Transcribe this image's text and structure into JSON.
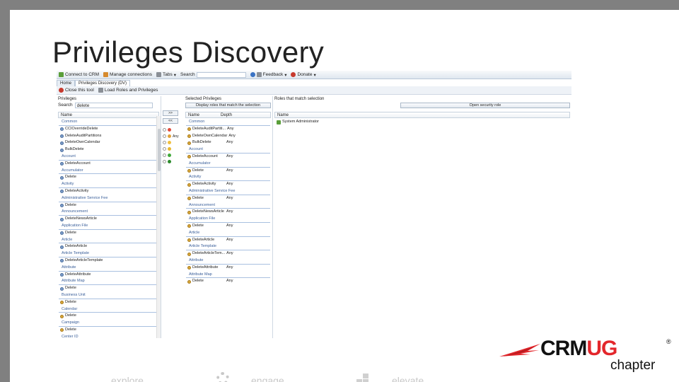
{
  "slide": {
    "title": "Privileges Discovery"
  },
  "toolbar": {
    "connect": "Connect to CRM",
    "manage": "Manage connections",
    "tabs": "Tabs",
    "search_label": "Search",
    "feedback": "Feedback",
    "donate": "Donate"
  },
  "tabs": [
    {
      "label": "Home"
    },
    {
      "label": "Privileges Discovery (DV)"
    }
  ],
  "actions": {
    "close": "Close this tool",
    "load": "Load Roles and Privileges"
  },
  "privileges_panel": {
    "title": "Privileges",
    "search_label": "Search",
    "search_value": "delete",
    "col_name": "Name",
    "add_btn": ">>",
    "remove_btn": "<<",
    "rows": [
      {
        "t": "g",
        "text": "Common"
      },
      {
        "t": "r",
        "text": "CCIOverrideDelete",
        "k": "blue"
      },
      {
        "t": "r",
        "text": "DeleteAuditPartitions",
        "k": "blue"
      },
      {
        "t": "r",
        "text": "DeleteOwnCalendar",
        "k": "blue"
      },
      {
        "t": "r",
        "text": "BulkDelete",
        "k": "blue"
      },
      {
        "t": "g",
        "text": "Account"
      },
      {
        "t": "r",
        "text": "DeleteAccount",
        "k": "blue"
      },
      {
        "t": "g",
        "text": "Accumulator"
      },
      {
        "t": "r",
        "text": "Delete",
        "k": "blue"
      },
      {
        "t": "g",
        "text": "Activity"
      },
      {
        "t": "r",
        "text": "DeleteActivity",
        "k": "blue"
      },
      {
        "t": "g",
        "text": "Administrative Service Fee"
      },
      {
        "t": "r",
        "text": "Delete",
        "k": "blue"
      },
      {
        "t": "g",
        "text": "Announcement"
      },
      {
        "t": "r",
        "text": "DeleteNewsArticle",
        "k": "blue"
      },
      {
        "t": "g",
        "text": "Application File"
      },
      {
        "t": "r",
        "text": "Delete",
        "k": "blue"
      },
      {
        "t": "g",
        "text": "Article"
      },
      {
        "t": "r",
        "text": "DeleteArticle",
        "k": "blue"
      },
      {
        "t": "g",
        "text": "Article Template"
      },
      {
        "t": "r",
        "text": "DeleteArticleTemplate",
        "k": "blue"
      },
      {
        "t": "g",
        "text": "Attribute"
      },
      {
        "t": "r",
        "text": "DeleteAttribute",
        "k": "blue"
      },
      {
        "t": "g",
        "text": "Attribute Map"
      },
      {
        "t": "r",
        "text": "Delete",
        "k": "blue"
      },
      {
        "t": "g",
        "text": "Business Unit"
      },
      {
        "t": "r",
        "text": "Delete",
        "k": "gold"
      },
      {
        "t": "g",
        "text": "Calendar"
      },
      {
        "t": "r",
        "text": "Delete",
        "k": "gold"
      },
      {
        "t": "g",
        "text": "Campaign"
      },
      {
        "t": "r",
        "text": "Delete",
        "k": "gold"
      },
      {
        "t": "g",
        "text": "Center ID"
      }
    ]
  },
  "middle": {
    "radios": [
      "",
      "Any",
      "",
      "",
      "",
      ""
    ]
  },
  "selected_panel": {
    "title": "Selected Privileges",
    "display_btn": "Display roles that match the selection",
    "col_name": "Name",
    "col_depth": "Depth",
    "rows": [
      {
        "t": "g",
        "text": "Common"
      },
      {
        "t": "r",
        "text": "DeleteAuditPartiti...",
        "d": "Any"
      },
      {
        "t": "r",
        "text": "DeleteOwnCalendar",
        "d": "Any"
      },
      {
        "t": "r",
        "text": "BulkDelete",
        "d": "Any"
      },
      {
        "t": "g",
        "text": "Account"
      },
      {
        "t": "r",
        "text": "DeleteAccount",
        "d": "Any"
      },
      {
        "t": "g",
        "text": "Accumulator"
      },
      {
        "t": "r",
        "text": "Delete",
        "d": "Any"
      },
      {
        "t": "g",
        "text": "Activity"
      },
      {
        "t": "r",
        "text": "DeleteActivity",
        "d": "Any"
      },
      {
        "t": "g",
        "text": "Administrative Service Fee"
      },
      {
        "t": "r",
        "text": "Delete",
        "d": "Any"
      },
      {
        "t": "g",
        "text": "Announcement"
      },
      {
        "t": "r",
        "text": "DeleteNewsArticle",
        "d": "Any"
      },
      {
        "t": "g",
        "text": "Application File"
      },
      {
        "t": "r",
        "text": "Delete",
        "d": "Any"
      },
      {
        "t": "g",
        "text": "Article"
      },
      {
        "t": "r",
        "text": "DeleteArticle",
        "d": "Any"
      },
      {
        "t": "g",
        "text": "Article Template"
      },
      {
        "t": "r",
        "text": "DeleteArticleTem...",
        "d": "Any"
      },
      {
        "t": "g",
        "text": "Attribute"
      },
      {
        "t": "r",
        "text": "DeleteAttribute",
        "d": "Any"
      },
      {
        "t": "g",
        "text": "Attribute Map"
      },
      {
        "t": "r",
        "text": "Delete",
        "d": "Any"
      }
    ]
  },
  "roles_panel": {
    "title": "Roles that match selection",
    "open_btn": "Open security role",
    "col_name": "Name",
    "rows": [
      {
        "text": "System Administrator"
      }
    ]
  },
  "footer": {
    "explore": "explore",
    "engage": "engage",
    "elevate": "elevate"
  },
  "logo": {
    "crm": "CRM",
    "ug": "UG",
    "reg": "®",
    "sub": "chapter",
    "brand_red": "#e3262b"
  }
}
